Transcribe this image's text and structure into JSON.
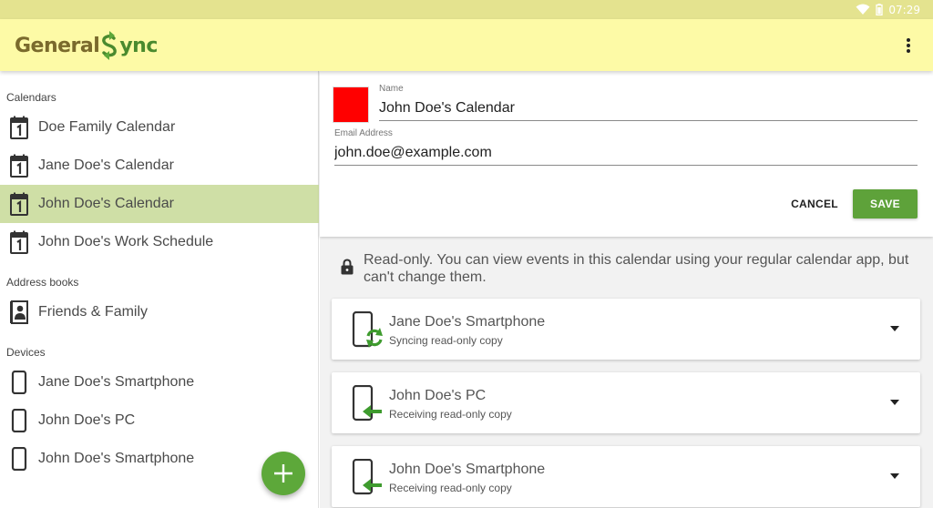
{
  "status_bar": {
    "time": "07:29"
  },
  "app": {
    "logo_part1": "General",
    "logo_part2": "ync",
    "brand_color": "#5da83a",
    "bar_color": "#fdfaa6"
  },
  "sidebar": {
    "calendars_header": "Calendars",
    "calendars": [
      {
        "label": "Doe Family Calendar",
        "selected": false
      },
      {
        "label": "Jane Doe's Calendar",
        "selected": false
      },
      {
        "label": "John Doe's Calendar",
        "selected": true
      },
      {
        "label": "John Doe's Work Schedule",
        "selected": false
      }
    ],
    "address_books_header": "Address books",
    "address_books": [
      {
        "label": "Friends & Family"
      }
    ],
    "devices_header": "Devices",
    "devices": [
      {
        "label": "Jane Doe's Smartphone"
      },
      {
        "label": "John Doe's PC"
      },
      {
        "label": "John Doe's Smartphone"
      }
    ]
  },
  "form": {
    "name_label": "Name",
    "name_value": "John Doe's Calendar",
    "email_label": "Email Address",
    "email_value": "john.doe@example.com",
    "calendar_color": "#ff0000",
    "cancel_label": "CANCEL",
    "save_label": "SAVE"
  },
  "readonly_note": "Read-only. You can view events in this calendar using your regular calendar app, but can't change them.",
  "device_cards": [
    {
      "name": "Jane Doe's Smartphone",
      "status": "Syncing read-only copy",
      "icon": "phone-sync-icon"
    },
    {
      "name": "John Doe's PC",
      "status": "Receiving read-only copy",
      "icon": "pc-receive-icon"
    },
    {
      "name": "John Doe's Smartphone",
      "status": "Receiving read-only copy",
      "icon": "phone-receive-icon"
    }
  ]
}
